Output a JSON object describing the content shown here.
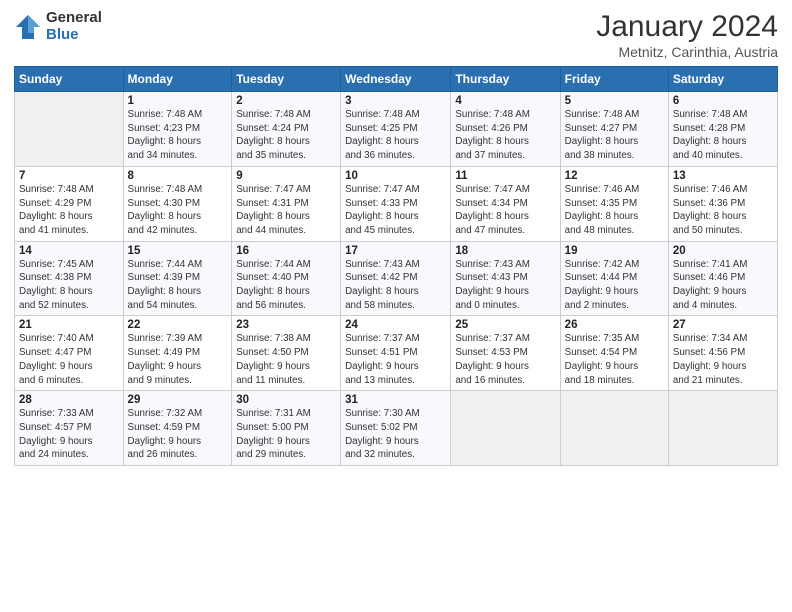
{
  "header": {
    "logo_general": "General",
    "logo_blue": "Blue",
    "title": "January 2024",
    "subtitle": "Metnitz, Carinthia, Austria"
  },
  "days_of_week": [
    "Sunday",
    "Monday",
    "Tuesday",
    "Wednesday",
    "Thursday",
    "Friday",
    "Saturday"
  ],
  "weeks": [
    [
      {
        "day": "",
        "info": ""
      },
      {
        "day": "1",
        "info": "Sunrise: 7:48 AM\nSunset: 4:23 PM\nDaylight: 8 hours\nand 34 minutes."
      },
      {
        "day": "2",
        "info": "Sunrise: 7:48 AM\nSunset: 4:24 PM\nDaylight: 8 hours\nand 35 minutes."
      },
      {
        "day": "3",
        "info": "Sunrise: 7:48 AM\nSunset: 4:25 PM\nDaylight: 8 hours\nand 36 minutes."
      },
      {
        "day": "4",
        "info": "Sunrise: 7:48 AM\nSunset: 4:26 PM\nDaylight: 8 hours\nand 37 minutes."
      },
      {
        "day": "5",
        "info": "Sunrise: 7:48 AM\nSunset: 4:27 PM\nDaylight: 8 hours\nand 38 minutes."
      },
      {
        "day": "6",
        "info": "Sunrise: 7:48 AM\nSunset: 4:28 PM\nDaylight: 8 hours\nand 40 minutes."
      }
    ],
    [
      {
        "day": "7",
        "info": "Sunrise: 7:48 AM\nSunset: 4:29 PM\nDaylight: 8 hours\nand 41 minutes."
      },
      {
        "day": "8",
        "info": "Sunrise: 7:48 AM\nSunset: 4:30 PM\nDaylight: 8 hours\nand 42 minutes."
      },
      {
        "day": "9",
        "info": "Sunrise: 7:47 AM\nSunset: 4:31 PM\nDaylight: 8 hours\nand 44 minutes."
      },
      {
        "day": "10",
        "info": "Sunrise: 7:47 AM\nSunset: 4:33 PM\nDaylight: 8 hours\nand 45 minutes."
      },
      {
        "day": "11",
        "info": "Sunrise: 7:47 AM\nSunset: 4:34 PM\nDaylight: 8 hours\nand 47 minutes."
      },
      {
        "day": "12",
        "info": "Sunrise: 7:46 AM\nSunset: 4:35 PM\nDaylight: 8 hours\nand 48 minutes."
      },
      {
        "day": "13",
        "info": "Sunrise: 7:46 AM\nSunset: 4:36 PM\nDaylight: 8 hours\nand 50 minutes."
      }
    ],
    [
      {
        "day": "14",
        "info": "Sunrise: 7:45 AM\nSunset: 4:38 PM\nDaylight: 8 hours\nand 52 minutes."
      },
      {
        "day": "15",
        "info": "Sunrise: 7:44 AM\nSunset: 4:39 PM\nDaylight: 8 hours\nand 54 minutes."
      },
      {
        "day": "16",
        "info": "Sunrise: 7:44 AM\nSunset: 4:40 PM\nDaylight: 8 hours\nand 56 minutes."
      },
      {
        "day": "17",
        "info": "Sunrise: 7:43 AM\nSunset: 4:42 PM\nDaylight: 8 hours\nand 58 minutes."
      },
      {
        "day": "18",
        "info": "Sunrise: 7:43 AM\nSunset: 4:43 PM\nDaylight: 9 hours\nand 0 minutes."
      },
      {
        "day": "19",
        "info": "Sunrise: 7:42 AM\nSunset: 4:44 PM\nDaylight: 9 hours\nand 2 minutes."
      },
      {
        "day": "20",
        "info": "Sunrise: 7:41 AM\nSunset: 4:46 PM\nDaylight: 9 hours\nand 4 minutes."
      }
    ],
    [
      {
        "day": "21",
        "info": "Sunrise: 7:40 AM\nSunset: 4:47 PM\nDaylight: 9 hours\nand 6 minutes."
      },
      {
        "day": "22",
        "info": "Sunrise: 7:39 AM\nSunset: 4:49 PM\nDaylight: 9 hours\nand 9 minutes."
      },
      {
        "day": "23",
        "info": "Sunrise: 7:38 AM\nSunset: 4:50 PM\nDaylight: 9 hours\nand 11 minutes."
      },
      {
        "day": "24",
        "info": "Sunrise: 7:37 AM\nSunset: 4:51 PM\nDaylight: 9 hours\nand 13 minutes."
      },
      {
        "day": "25",
        "info": "Sunrise: 7:37 AM\nSunset: 4:53 PM\nDaylight: 9 hours\nand 16 minutes."
      },
      {
        "day": "26",
        "info": "Sunrise: 7:35 AM\nSunset: 4:54 PM\nDaylight: 9 hours\nand 18 minutes."
      },
      {
        "day": "27",
        "info": "Sunrise: 7:34 AM\nSunset: 4:56 PM\nDaylight: 9 hours\nand 21 minutes."
      }
    ],
    [
      {
        "day": "28",
        "info": "Sunrise: 7:33 AM\nSunset: 4:57 PM\nDaylight: 9 hours\nand 24 minutes."
      },
      {
        "day": "29",
        "info": "Sunrise: 7:32 AM\nSunset: 4:59 PM\nDaylight: 9 hours\nand 26 minutes."
      },
      {
        "day": "30",
        "info": "Sunrise: 7:31 AM\nSunset: 5:00 PM\nDaylight: 9 hours\nand 29 minutes."
      },
      {
        "day": "31",
        "info": "Sunrise: 7:30 AM\nSunset: 5:02 PM\nDaylight: 9 hours\nand 32 minutes."
      },
      {
        "day": "",
        "info": ""
      },
      {
        "day": "",
        "info": ""
      },
      {
        "day": "",
        "info": ""
      }
    ]
  ]
}
